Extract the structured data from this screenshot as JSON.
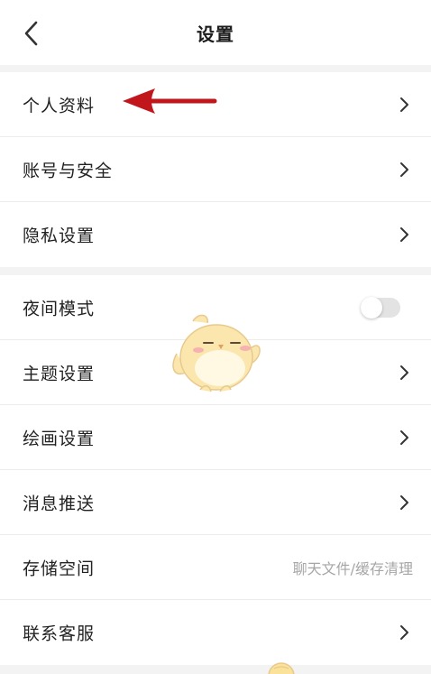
{
  "header": {
    "title": "设置",
    "back_icon": "chevron-left-icon"
  },
  "groups": [
    {
      "items": [
        {
          "label": "个人资料",
          "accessory": "chevron",
          "annotated": true
        },
        {
          "label": "账号与安全",
          "accessory": "chevron"
        },
        {
          "label": "隐私设置",
          "accessory": "chevron"
        }
      ]
    },
    {
      "items": [
        {
          "label": "夜间模式",
          "accessory": "toggle",
          "toggle_on": false
        },
        {
          "label": "主题设置",
          "accessory": "chevron"
        },
        {
          "label": "绘画设置",
          "accessory": "chevron"
        },
        {
          "label": "消息推送",
          "accessory": "chevron"
        },
        {
          "label": "存储空间",
          "accessory": "text",
          "value": "聊天文件/缓存清理"
        },
        {
          "label": "联系客服",
          "accessory": "chevron"
        }
      ]
    }
  ],
  "colors": {
    "background": "#f3f3f3",
    "row_background": "#ffffff",
    "label": "#222222",
    "secondary_text": "#a6a6a6",
    "annotation_arrow": "#c0161c",
    "toggle_track_off": "#e3e3e3"
  },
  "decorations": {
    "annotation": "red-arrow-icon",
    "mascot": "chick-mascot-icon"
  }
}
